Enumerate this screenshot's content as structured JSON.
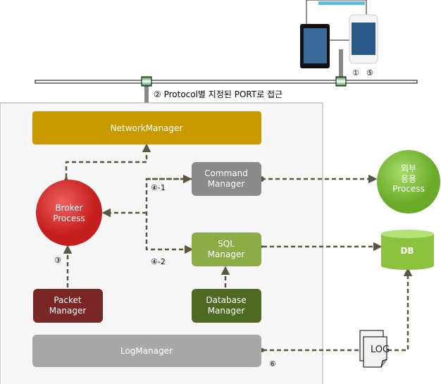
{
  "protocol_label": "② Protocol별 지정된 PORT로 접근",
  "step_labels": {
    "s1": "①",
    "s5": "⑤",
    "s3": "③",
    "s41": "④-1",
    "s42": "④-2",
    "s6": "⑥"
  },
  "nodes": {
    "network_manager": "NetworkManager",
    "command_manager": [
      "Command",
      "Manager"
    ],
    "broker_process": [
      "Broker",
      "Process"
    ],
    "sql_manager": [
      "SQL",
      "Manager"
    ],
    "packet_manager": [
      "Packet",
      "Manager"
    ],
    "database_manager": [
      "Database",
      "Manager"
    ],
    "log_manager": "LogManager",
    "external_process": [
      "외부",
      "응용",
      "Process"
    ],
    "db": "DB",
    "log": "LOG"
  },
  "colors": {
    "network": "#c99a00",
    "command": "#8a8a8a",
    "broker": "#d42a2a",
    "sql": "#8cac48",
    "packet": "#7a2626",
    "database": "#4e6a22",
    "log": "#a8a8a8",
    "external": "#7dbb3a",
    "db": "#8cc23e",
    "connector": "#5a5640"
  }
}
